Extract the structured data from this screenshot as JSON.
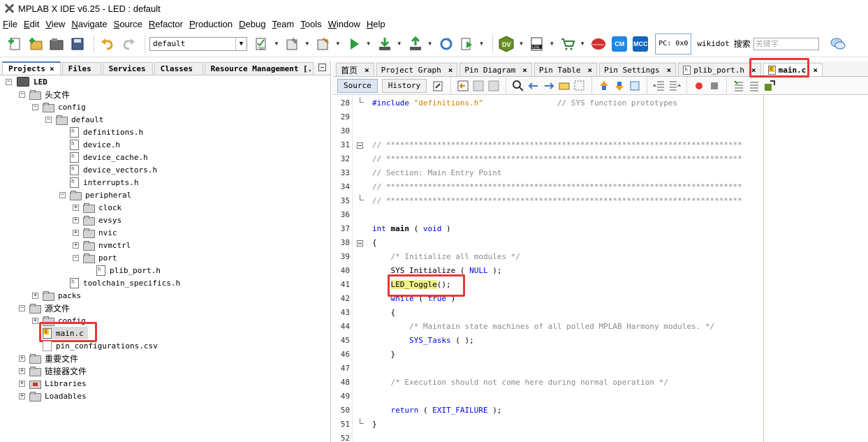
{
  "window": {
    "title": "MPLAB X IDE v6.25 - LED : default"
  },
  "menu": [
    "File",
    "Edit",
    "View",
    "Navigate",
    "Source",
    "Refactor",
    "Production",
    "Debug",
    "Team",
    "Tools",
    "Window",
    "Help"
  ],
  "toolbar": {
    "config_value": "default",
    "pc_label": "PC: 0x0",
    "wikidot_label": "wikidot",
    "search_label": "搜索",
    "search_placeholder": "关键字",
    "dv_label": "DV",
    "log_label": "LOG",
    "cm_label": "CM",
    "mcc_label": "MCC",
    "src_label": "SRC",
    "harmony_label": "Harmony",
    "colors": {
      "dv_green": "#6b8e23",
      "cm_blue": "#1e88e5",
      "mcc_blue": "#1565c0",
      "harmony_red": "#d32f2f"
    }
  },
  "left_panel": {
    "tabs": [
      {
        "label": "Projects",
        "close": "×",
        "active": true
      },
      {
        "label": "Files"
      },
      {
        "label": "Services"
      },
      {
        "label": "Classes"
      },
      {
        "label": "Resource Management [..."
      }
    ],
    "tree": {
      "project": "LED",
      "header_files": "头文件",
      "config": "config",
      "default": "default",
      "default_files": [
        "definitions.h",
        "device.h",
        "device_cache.h",
        "device_vectors.h",
        "interrupts.h"
      ],
      "peripheral": "peripheral",
      "peripheral_children": [
        "clock",
        "evsys",
        "nvic",
        "nvmctrl",
        "port"
      ],
      "port_file": "plib_port.h",
      "toolchain_file": "toolchain_specifics.h",
      "packs": "packs",
      "source_files": "源文件",
      "src_config": "config",
      "main_c": "main.c",
      "pin_csv": "pin_configurations.csv",
      "important_files": "重要文件",
      "linker_files": "链接器文件",
      "libraries": "Libraries",
      "loadables": "Loadables"
    }
  },
  "editor": {
    "tabs": [
      {
        "label": "首页"
      },
      {
        "label": "Project Graph"
      },
      {
        "label": "Pin Diagram"
      },
      {
        "label": "Pin Table"
      },
      {
        "label": "Pin Settings"
      },
      {
        "label": "plib_port.h"
      },
      {
        "label": "main.c",
        "active": true
      }
    ],
    "tab_close": "×",
    "source_button": "Source",
    "history_button": "History",
    "lines": [
      {
        "n": "28",
        "code": "#include \"definitions.h\"                // SYS function prototypes"
      },
      {
        "n": "29",
        "code": ""
      },
      {
        "n": "30",
        "code": ""
      },
      {
        "n": "31",
        "code": "// *****************************************************************************"
      },
      {
        "n": "32",
        "code": "// *****************************************************************************"
      },
      {
        "n": "33",
        "code": "// Section: Main Entry Point"
      },
      {
        "n": "34",
        "code": "// *****************************************************************************"
      },
      {
        "n": "35",
        "code": "// *****************************************************************************"
      },
      {
        "n": "36",
        "code": ""
      },
      {
        "n": "37",
        "code": "int main ( void )"
      },
      {
        "n": "38",
        "code": "{"
      },
      {
        "n": "39",
        "code": "    /* Initialize all modules */"
      },
      {
        "n": "40",
        "code": "    SYS_Initialize ( NULL );"
      },
      {
        "n": "41",
        "code": "    LED_Toggle();"
      },
      {
        "n": "42",
        "code": "    while ( true )"
      },
      {
        "n": "43",
        "code": "    {"
      },
      {
        "n": "44",
        "code": "        /* Maintain state machines of all polled MPLAB Harmony modules. */"
      },
      {
        "n": "45",
        "code": "        SYS_Tasks ( );"
      },
      {
        "n": "46",
        "code": "    }"
      },
      {
        "n": "47",
        "code": ""
      },
      {
        "n": "48",
        "code": "    /* Execution should not come here during normal operation */"
      },
      {
        "n": "49",
        "code": ""
      },
      {
        "n": "50",
        "code": "    return ( EXIT_FAILURE );"
      },
      {
        "n": "51",
        "code": "}"
      },
      {
        "n": "52",
        "code": ""
      }
    ],
    "seg": {
      "inc": "#include",
      "inc_str": "\"definitions.h\"",
      "inc_cmt": "// SYS function prototypes",
      "stars": "// *****************************************************************************",
      "section": "// Section: Main Entry Point",
      "kw_int": "int",
      "fn_main": "main",
      "p_open": "(",
      "kw_void": "void",
      "p_close": ")",
      "brace_open": "{",
      "brace_close": "}",
      "c_init": "/* Initialize all modules */",
      "sys_init": "SYS_Initialize",
      "null": "NULL",
      "call_end": ");",
      "led_toggle": "LED_Toggle",
      "led_call": "();",
      "kw_while": "while",
      "kw_true": "true",
      "c_maintain": "/* Maintain state machines of all polled MPLAB Harmony modules. */",
      "sys_tasks": "SYS_Tasks",
      "sys_tasks_args": "( );",
      "c_exec": "/* Execution should not come here during normal operation */",
      "kw_return": "return",
      "exit_failure": "EXIT_FAILURE"
    }
  }
}
